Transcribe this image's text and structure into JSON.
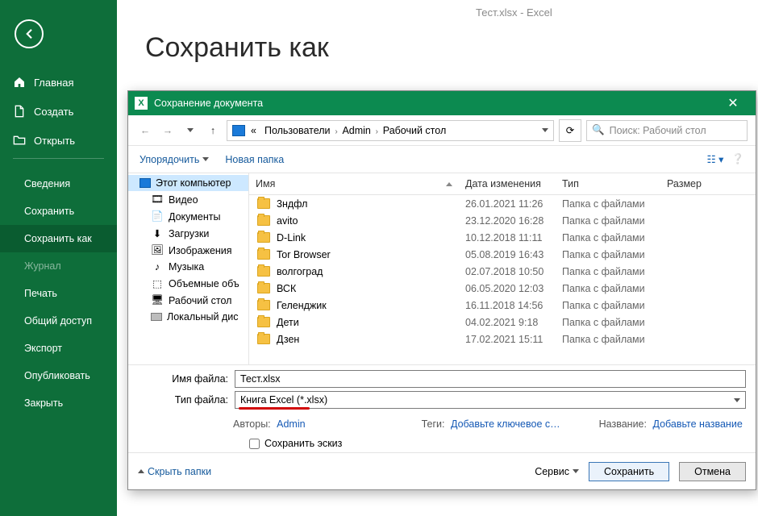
{
  "app_title": "Тест.xlsx  -  Excel",
  "page_heading": "Сохранить как",
  "sidebar": {
    "primary": [
      {
        "icon": "home",
        "label": "Главная"
      },
      {
        "icon": "new",
        "label": "Создать"
      },
      {
        "icon": "open",
        "label": "Открыть"
      }
    ],
    "secondary": [
      {
        "label": "Сведения",
        "active": false,
        "dim": false
      },
      {
        "label": "Сохранить",
        "active": false,
        "dim": false
      },
      {
        "label": "Сохранить как",
        "active": true,
        "dim": false
      },
      {
        "label": "Журнал",
        "active": false,
        "dim": true
      },
      {
        "label": "Печать",
        "active": false,
        "dim": false
      },
      {
        "label": "Общий доступ",
        "active": false,
        "dim": false
      },
      {
        "label": "Экспорт",
        "active": false,
        "dim": false
      },
      {
        "label": "Опубликовать",
        "active": false,
        "dim": false
      },
      {
        "label": "Закрыть",
        "active": false,
        "dim": false
      }
    ]
  },
  "dialog": {
    "title": "Сохранение документа",
    "breadcrumb_prefix": "«",
    "breadcrumbs": [
      "Пользователи",
      "Admin",
      "Рабочий стол"
    ],
    "search_placeholder": "Поиск: Рабочий стол",
    "organize": "Упорядочить",
    "new_folder": "Новая папка",
    "tree": [
      {
        "label": "Этот компьютер",
        "icon": "pc",
        "level": 1,
        "sel": true
      },
      {
        "label": "Видео",
        "icon": "video",
        "level": 2
      },
      {
        "label": "Документы",
        "icon": "doc",
        "level": 2
      },
      {
        "label": "Загрузки",
        "icon": "dl",
        "level": 2
      },
      {
        "label": "Изображения",
        "icon": "img",
        "level": 2
      },
      {
        "label": "Музыка",
        "icon": "music",
        "level": 2
      },
      {
        "label": "Объемные объ",
        "icon": "cube",
        "level": 2
      },
      {
        "label": "Рабочий стол",
        "icon": "desk",
        "level": 2
      },
      {
        "label": "Локальный дис",
        "icon": "drive",
        "level": 2
      }
    ],
    "columns": {
      "name": "Имя",
      "date": "Дата изменения",
      "type": "Тип",
      "size": "Размер"
    },
    "rows": [
      {
        "name": "3ндфл",
        "date": "26.01.2021 11:26",
        "type": "Папка с файлами"
      },
      {
        "name": "avito",
        "date": "23.12.2020 16:28",
        "type": "Папка с файлами"
      },
      {
        "name": "D-Link",
        "date": "10.12.2018 11:11",
        "type": "Папка с файлами"
      },
      {
        "name": "Tor Browser",
        "date": "05.08.2019 16:43",
        "type": "Папка с файлами"
      },
      {
        "name": "волгоград",
        "date": "02.07.2018 10:50",
        "type": "Папка с файлами"
      },
      {
        "name": "ВСК",
        "date": "06.05.2020 12:03",
        "type": "Папка с файлами"
      },
      {
        "name": "Геленджик",
        "date": "16.11.2018 14:56",
        "type": "Папка с файлами"
      },
      {
        "name": "Дети",
        "date": "04.02.2021 9:18",
        "type": "Папка с файлами"
      },
      {
        "name": "Дзен",
        "date": "17.02.2021 15:11",
        "type": "Папка с файлами"
      }
    ],
    "filename_label": "Имя файла:",
    "filename_value": "Тест.xlsx",
    "filetype_label": "Тип файла:",
    "filetype_value": "Книга Excel (*.xlsx)",
    "authors_label": "Авторы:",
    "authors_value": "Admin",
    "tags_label": "Теги:",
    "tags_placeholder": "Добавьте ключевое с…",
    "title_label": "Название:",
    "title_placeholder": "Добавьте название",
    "save_thumb": "Сохранить эскиз",
    "hide_folders": "Скрыть папки",
    "tools": "Сервис",
    "save_btn": "Сохранить",
    "cancel_btn": "Отмена"
  }
}
